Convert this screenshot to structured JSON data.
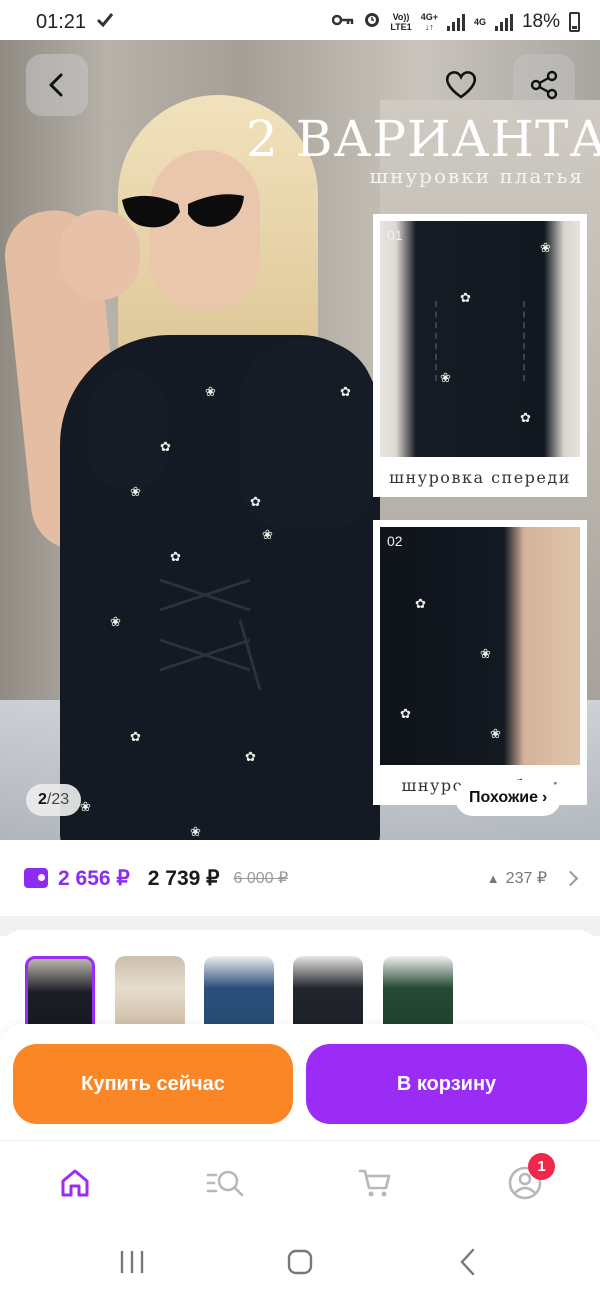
{
  "status_bar": {
    "time": "01:21",
    "network_volte": "Vo))",
    "network_lte": "LTE1",
    "network_4g_plus": "4G+",
    "network_4g": "4G",
    "battery": "18%"
  },
  "hero": {
    "title": "2 ВАРИАНТА",
    "subtitle": "шнуровки платья",
    "variant_cards": [
      {
        "number": "01",
        "caption": "шнуровка спереди"
      },
      {
        "number": "02",
        "caption": "шнуровка сбоку"
      }
    ],
    "counter_current": "2",
    "counter_total": "23",
    "counter_separator": "/",
    "similar_label": "Похожие",
    "similar_chevron": "›"
  },
  "price": {
    "card_price": "2 656 ₽",
    "price": "2 739 ₽",
    "old_price": "6 000 ₽",
    "points": "237 ₽",
    "points_arrow": "▲"
  },
  "variants": {
    "count": 5,
    "selected_index": 0
  },
  "actions": {
    "buy_now": "Купить сейчас",
    "add_to_cart": "В корзину"
  },
  "bottom_nav": {
    "items": [
      "home-icon",
      "catalog-search-icon",
      "cart-icon",
      "profile-icon"
    ],
    "active": "home",
    "profile_badge": "1"
  },
  "colors": {
    "accent_purple": "#9b2cf6",
    "accent_orange": "#fa8626",
    "badge_red": "#f0264b"
  }
}
